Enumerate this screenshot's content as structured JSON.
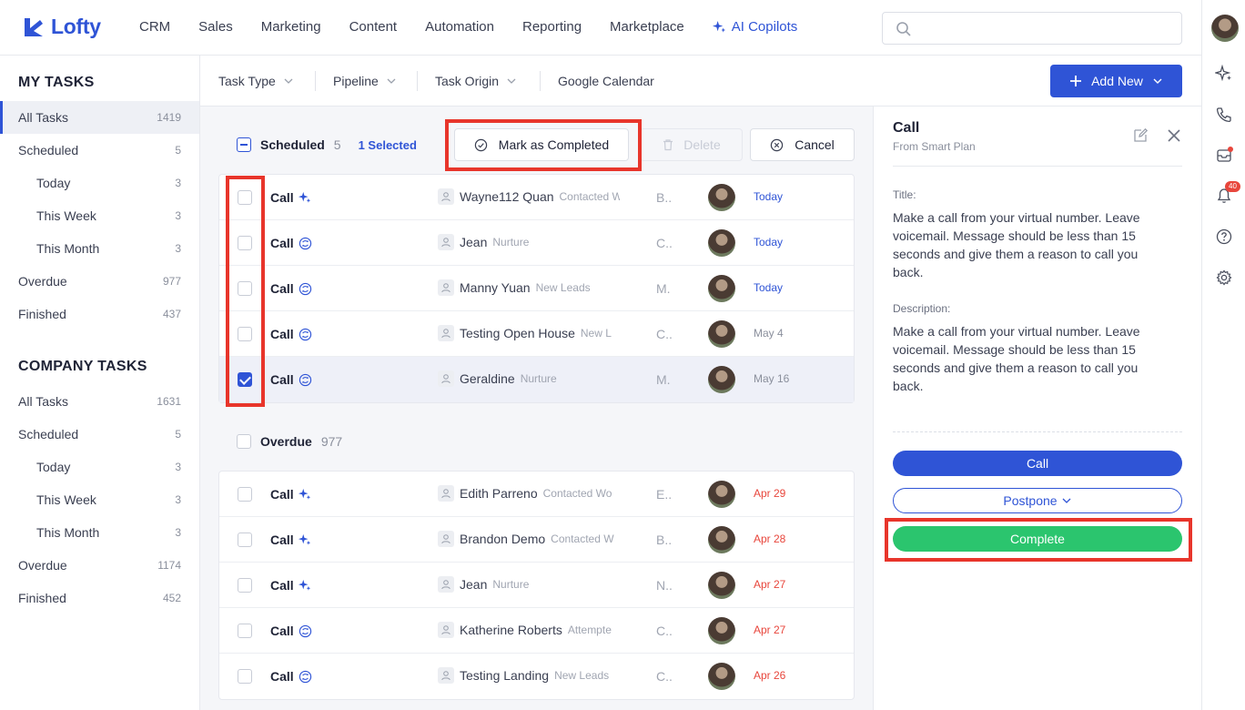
{
  "brand": {
    "name": "Lofty",
    "color": "#2f54d6"
  },
  "nav": {
    "items": [
      "CRM",
      "Sales",
      "Marketing",
      "Content",
      "Automation",
      "Reporting",
      "Marketplace"
    ],
    "ai_label": "AI Copilots",
    "search_placeholder": ""
  },
  "rail": {
    "notifications_badge": "40"
  },
  "sidebar": {
    "my_heading": "MY TASKS",
    "my_items": [
      {
        "label": "All Tasks",
        "count": "1419"
      },
      {
        "label": "Scheduled",
        "count": "5"
      },
      {
        "label": "Today",
        "count": "3"
      },
      {
        "label": "This Week",
        "count": "3"
      },
      {
        "label": "This Month",
        "count": "3"
      },
      {
        "label": "Overdue",
        "count": "977"
      },
      {
        "label": "Finished",
        "count": "437"
      }
    ],
    "company_heading": "COMPANY TASKS",
    "company_items": [
      {
        "label": "All Tasks",
        "count": "1631"
      },
      {
        "label": "Scheduled",
        "count": "5"
      },
      {
        "label": "Today",
        "count": "3"
      },
      {
        "label": "This Week",
        "count": "3"
      },
      {
        "label": "This Month",
        "count": "3"
      },
      {
        "label": "Overdue",
        "count": "1174"
      },
      {
        "label": "Finished",
        "count": "452"
      }
    ]
  },
  "filters": {
    "task_type": "Task Type",
    "pipeline": "Pipeline",
    "task_origin": "Task Origin",
    "google_calendar": "Google Calendar",
    "add_new": "Add New"
  },
  "scheduled": {
    "title": "Scheduled",
    "count": "5",
    "selected": "1 Selected",
    "mark_completed": "Mark as Completed",
    "delete": "Delete",
    "cancel": "Cancel",
    "rows": [
      {
        "type": "Call",
        "icon": "sparkle-icon",
        "name": "Wayne112 Quan",
        "tag": "Contacted W",
        "col3": "B..",
        "due": "Today",
        "due_style": "today",
        "checked": false
      },
      {
        "type": "Call",
        "icon": "smart-plan-icon",
        "name": "Jean",
        "tag": "Nurture",
        "col3": "C..",
        "due": "Today",
        "due_style": "today",
        "checked": false
      },
      {
        "type": "Call",
        "icon": "smart-plan-icon",
        "name": "Manny Yuan",
        "tag": "New Leads",
        "col3": "M.",
        "due": "Today",
        "due_style": "today",
        "checked": false
      },
      {
        "type": "Call",
        "icon": "smart-plan-icon",
        "name": "Testing Open House",
        "tag": "New L",
        "col3": "C..",
        "due": "May 4",
        "due_style": "gray",
        "checked": false
      },
      {
        "type": "Call",
        "icon": "smart-plan-icon",
        "name": "Geraldine",
        "tag": "Nurture",
        "col3": "M.",
        "due": "May 16",
        "due_style": "gray",
        "checked": true
      }
    ]
  },
  "overdue": {
    "title": "Overdue",
    "count": "977",
    "rows": [
      {
        "type": "Call",
        "icon": "sparkle-icon",
        "name": "Edith Parreno",
        "tag": "Contacted Wo",
        "col3": "E..",
        "due": "Apr 29",
        "due_style": "red"
      },
      {
        "type": "Call",
        "icon": "sparkle-icon",
        "name": "Brandon Demo",
        "tag": "Contacted W",
        "col3": "B..",
        "due": "Apr 28",
        "due_style": "red"
      },
      {
        "type": "Call",
        "icon": "sparkle-icon",
        "name": "Jean",
        "tag": "Nurture",
        "col3": "N..",
        "due": "Apr 27",
        "due_style": "red"
      },
      {
        "type": "Call",
        "icon": "smart-plan-icon",
        "name": "Katherine Roberts",
        "tag": "Attempte",
        "col3": "C..",
        "due": "Apr 27",
        "due_style": "red"
      },
      {
        "type": "Call",
        "icon": "smart-plan-icon",
        "name": "Testing Landing",
        "tag": "New Leads",
        "col3": "C..",
        "due": "Apr 26",
        "due_style": "red"
      }
    ]
  },
  "detail": {
    "title": "Call",
    "subtitle": "From Smart Plan",
    "title_label": "Title:",
    "title_text": "Make a call from your virtual number. Leave voicemail. Message should be less than 15 seconds and give them a reason to call you back.",
    "description_label": "Description:",
    "description_text": "Make a call from your virtual number. Leave voicemail. Message should be less than 15 seconds and give them a reason to call you back.",
    "call_button": "Call",
    "postpone_button": "Postpone",
    "complete_button": "Complete"
  },
  "colors": {
    "primary": "#2f54d6",
    "complete": "#2bc56e",
    "overdue": "#e8463c",
    "highlight": "#e8352b"
  }
}
